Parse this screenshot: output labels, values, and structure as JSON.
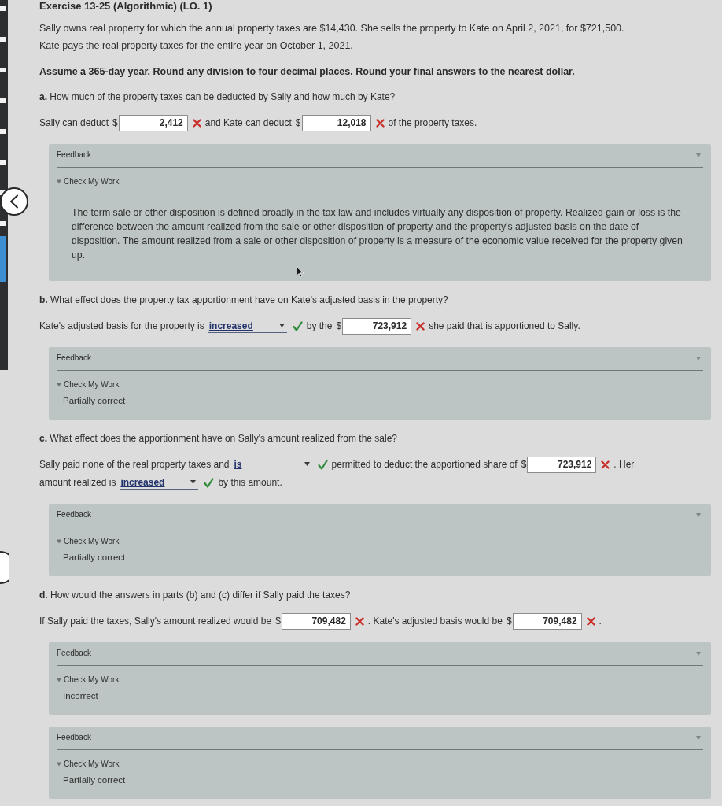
{
  "title": "Exercise 13-25 (Algorithmic) (LO. 1)",
  "intro": "Sally owns real property for which the annual property taxes are $14,430. She sells the property to Kate on April 2, 2021, for $721,500. Kate pays the real property taxes for the entire year on October 1, 2021.",
  "instructions": "Assume a 365-day year. Round any division to four decimal places. Round your final answers to the nearest dollar.",
  "parts": [
    {
      "letter": "a.",
      "question": "How much of the property taxes can be deducted by Sally and how much by Kate?",
      "lines": [
        [
          {
            "kind": "text",
            "text": "Sally can deduct"
          },
          {
            "kind": "amount",
            "currency": "$",
            "value": "2,412",
            "correct": false
          },
          {
            "kind": "text",
            "text": "and Kate can deduct"
          },
          {
            "kind": "amount",
            "currency": "$",
            "value": "12,018",
            "correct": false
          },
          {
            "kind": "text",
            "text": "of the property taxes."
          }
        ]
      ],
      "feedback": {
        "label": "Feedback",
        "check_label": "Check My Work",
        "expanded": true,
        "kind": "explanation",
        "message": "The term sale or other disposition is defined broadly in the tax law and includes virtually any disposition of property. Realized gain or loss is the difference between the amount realized from the sale or other disposition of property and the property's adjusted basis on the date of disposition. The amount realized from a sale or other disposition of property is a measure of the economic value received for the property given up."
      }
    },
    {
      "letter": "b.",
      "question": "What effect does the property tax apportionment have on Kate's adjusted basis in the property?",
      "lines": [
        [
          {
            "kind": "text",
            "text": "Kate's adjusted basis for the property is"
          },
          {
            "kind": "select",
            "value": "increased",
            "correct": true
          },
          {
            "kind": "text",
            "text": "by the"
          },
          {
            "kind": "amount",
            "currency": "$",
            "value": "723,912",
            "correct": false
          },
          {
            "kind": "text",
            "text": "she paid that is apportioned to Sally."
          }
        ]
      ],
      "feedback": {
        "label": "Feedback",
        "check_label": "Check My Work",
        "expanded": true,
        "kind": "status",
        "message": "Partially correct"
      }
    },
    {
      "letter": "c.",
      "question": "What effect does the apportionment have on Sally's amount realized from the sale?",
      "lines": [
        [
          {
            "kind": "text",
            "text": "Sally paid none of the real property taxes and"
          },
          {
            "kind": "select",
            "value": "is",
            "correct": true
          },
          {
            "kind": "text",
            "text": "permitted to deduct the apportioned share of"
          },
          {
            "kind": "amount",
            "currency": "$",
            "value": "723,912",
            "correct": false
          },
          {
            "kind": "text",
            "text": ". Her"
          }
        ],
        [
          {
            "kind": "text",
            "text": "amount realized is"
          },
          {
            "kind": "select",
            "value": "increased",
            "correct": true
          },
          {
            "kind": "text",
            "text": "by this amount."
          }
        ]
      ],
      "feedback": {
        "label": "Feedback",
        "check_label": "Check My Work",
        "expanded": true,
        "kind": "status",
        "message": "Partially correct"
      }
    },
    {
      "letter": "d.",
      "question": "How would the answers in parts (b) and (c) differ if Sally paid the taxes?",
      "lines": [
        [
          {
            "kind": "text",
            "text": "If Sally paid the taxes, Sally's amount realized would be"
          },
          {
            "kind": "amount",
            "currency": "$",
            "value": "709,482",
            "correct": false
          },
          {
            "kind": "text",
            "text": ". Kate's adjusted basis would be"
          },
          {
            "kind": "amount",
            "currency": "$",
            "value": "709,482",
            "correct": false
          },
          {
            "kind": "text",
            "text": "."
          }
        ]
      ],
      "feedback": {
        "label": "Feedback",
        "check_label": "Check My Work",
        "expanded": true,
        "kind": "status",
        "message": "Incorrect"
      }
    }
  ],
  "extra_feedback": {
    "label": "Feedback",
    "check_label": "Check My Work",
    "expanded": true,
    "kind": "status",
    "message": "Partially correct"
  }
}
